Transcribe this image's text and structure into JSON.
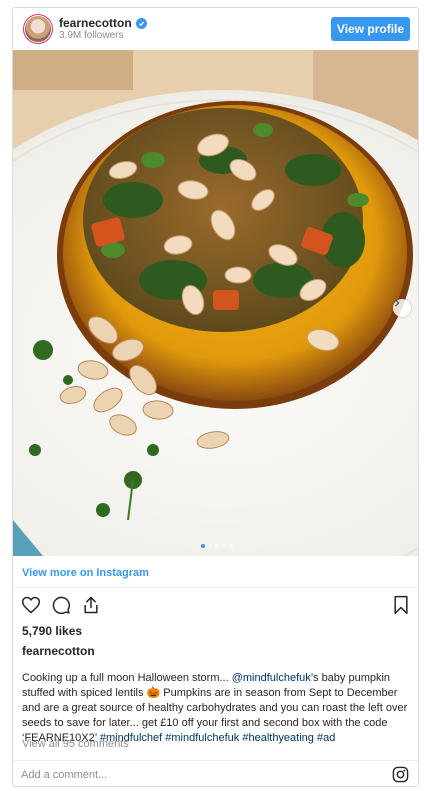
{
  "header": {
    "username": "fearnecotton",
    "followers": "3.9M followers",
    "view_profile_label": "View profile",
    "verified_icon": "verified-badge-icon"
  },
  "media": {
    "description_icon": "post-photo",
    "carousel_dots": 5,
    "active_dot_index": 0,
    "next_icon": "chevron-right-icon"
  },
  "view_more_label": "View more on Instagram",
  "actions": {
    "like_icon": "heart-icon",
    "comment_icon": "comment-icon",
    "share_icon": "share-icon",
    "save_icon": "bookmark-icon"
  },
  "likes": "5,790 likes",
  "author": "fearnecotton",
  "caption": {
    "part1": "Cooking up a full moon Halloween storm... ",
    "mention": "@mindfulchefuk",
    "part2": "’s baby pumpkin stuffed with spiced lentils 🎃 Pumpkins are in season from Sept to December and are a great source of healthy carbohydrates and you can roast the left over seeds to save for later... get £10 off your first and second box with the code ‘FEARNE10X2’ ",
    "hashtag1": "#mindfulchef",
    "hashtag2": "#mindfulchefuk",
    "hashtag3": "#healthyeating",
    "hashtag4": "#ad"
  },
  "comments_label": "View all 95 comments",
  "comment_placeholder": "Add a comment...",
  "colors": {
    "accent": "#3897f0",
    "link": "#003569",
    "muted": "#8e8e8e",
    "text": "#262626"
  }
}
